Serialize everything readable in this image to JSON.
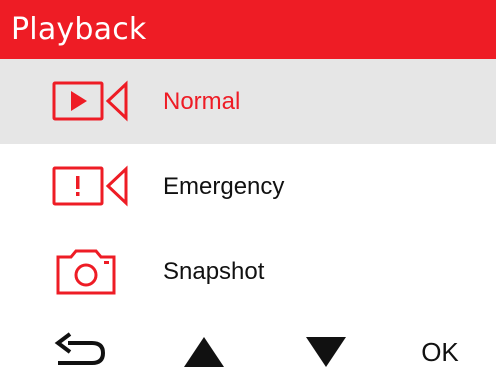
{
  "header": {
    "title": "Playback",
    "background_color": "#ee1c25"
  },
  "menu": {
    "accent_color": "#ee1c25",
    "selected_background": "#e6e6e6",
    "items": [
      {
        "label": "Normal",
        "icon": "video-play-icon",
        "selected": true
      },
      {
        "label": "Emergency",
        "icon": "video-emergency-icon",
        "selected": false
      },
      {
        "label": "Snapshot",
        "icon": "camera-icon",
        "selected": false
      }
    ]
  },
  "footer": {
    "buttons": [
      {
        "icon": "back-arrow-icon"
      },
      {
        "icon": "up-triangle-icon"
      },
      {
        "icon": "down-triangle-icon"
      },
      {
        "label": "OK"
      }
    ]
  }
}
